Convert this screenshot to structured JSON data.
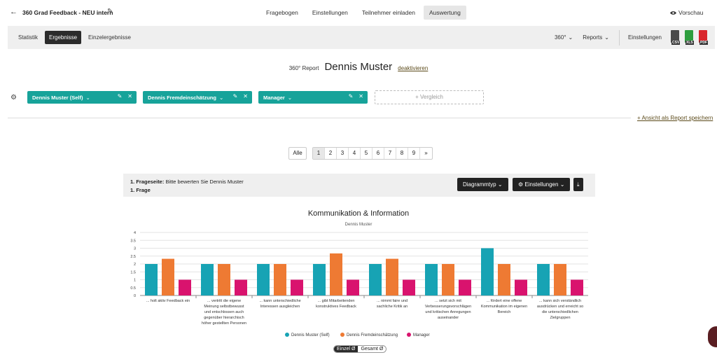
{
  "header": {
    "back_icon": "arrow-left-icon",
    "title": "360 Grad Feedback - NEU intern",
    "nav": [
      {
        "label": "Fragebogen",
        "active": false
      },
      {
        "label": "Einstellungen",
        "active": false
      },
      {
        "label": "Teilnehmer einladen",
        "active": false
      },
      {
        "label": "Auswertung",
        "active": true
      }
    ],
    "preview_label": "Vorschau"
  },
  "subnav": {
    "tabs": [
      {
        "label": "Statistik",
        "active": false
      },
      {
        "label": "Ergebnisse",
        "active": true
      },
      {
        "label": "Einzelergebnisse",
        "active": false
      }
    ],
    "dropdown_360": "360°",
    "dropdown_reports": "Reports",
    "settings_label": "Einstellungen",
    "exports": [
      {
        "label": "CSV",
        "color": "#4a4a4a"
      },
      {
        "label": "XLS",
        "color": "#2e9e3e"
      },
      {
        "label": "PDF",
        "color": "#d9262c"
      }
    ]
  },
  "report": {
    "label": "360° Report",
    "name": "Dennis Muster",
    "deactivate": "deaktivieren"
  },
  "filters": {
    "chips": [
      "Dennis Muster (Self)",
      "Dennis Fremdeinschätzung",
      "Manager"
    ],
    "compare_label": "+ Vergleich",
    "save_report_label": "+ Ansicht als Report speichern",
    "accent": "#17a39a"
  },
  "pagination": {
    "all_label": "Alle",
    "pages": [
      "1",
      "2",
      "3",
      "4",
      "5",
      "6",
      "7",
      "8",
      "9",
      "»"
    ],
    "active": "1"
  },
  "question": {
    "page_prefix": "1. Frageseite:",
    "page_text": "Bitte bewerten Sie Dennis Muster",
    "question_label": "1. Frage",
    "diagram_type_label": "Diagrammtyp",
    "settings_label": "Einstellungen"
  },
  "chart_data": {
    "type": "bar",
    "title": "Kommunikation & Information",
    "subtitle": "Dennis Muster",
    "ylim": [
      0,
      4
    ],
    "yticks": [
      "0",
      "0.5",
      "1",
      "1.5",
      "2",
      "2.5",
      "3",
      "3.5",
      "4"
    ],
    "categories": [
      "... holt aktiv Feedback ein",
      "... vertritt die eigene Meinung selbstbewusst und entschlossen auch gegenüber hierarchisch höher gestellten Personen",
      "... kann unterschiedliche Interessen ausgleichen",
      "... gibt Mitarbeitenden konstruktives Feedback",
      "... nimmt faire und sachliche Kritik an",
      "... setzt sich mit Verbesserungsvorschlägen und kritischen Anregungen auseinander",
      "... fördert eine offene Kommunikation im eigenen Bereich",
      "... kann sich verständlich ausdrücken und erreicht so die unterschiedlichen Zielgruppen"
    ],
    "category_lines": [
      [
        "... holt aktiv Feedback ein"
      ],
      [
        "... vertritt die eigene",
        "Meinung selbstbewusst",
        "und entschlossen auch",
        "gegenüber hierarchisch",
        "höher gestellten Personen"
      ],
      [
        "... kann unterschiedliche",
        "Interessen ausgleichen"
      ],
      [
        "... gibt Mitarbeitenden",
        "konstruktives Feedback"
      ],
      [
        "... nimmt faire und",
        "sachliche Kritik an"
      ],
      [
        "... setzt sich mit",
        "Verbesserungsvorschlägen",
        "und kritischen Anregungen",
        "auseinander"
      ],
      [
        "... fördert eine offene",
        "Kommunikation im eigenen",
        "Bereich"
      ],
      [
        "... kann sich verständlich",
        "ausdrücken und erreicht so",
        "die unterschiedlichen",
        "Zielgruppen"
      ]
    ],
    "series": [
      {
        "name": "Dennis Muster (Self)",
        "color": "#17a3b4",
        "values": [
          2,
          2,
          2,
          2,
          2,
          2,
          3,
          2
        ]
      },
      {
        "name": "Dennis Fremdeinschätzung",
        "color": "#ee7a33",
        "values": [
          2.33,
          2,
          2,
          2.67,
          2.33,
          2,
          2,
          2
        ]
      },
      {
        "name": "Manager",
        "color": "#d9136e",
        "values": [
          1,
          1,
          1,
          1,
          1,
          1,
          1,
          1
        ]
      }
    ],
    "grid": true,
    "legend": "bottom"
  },
  "view_toggle": [
    {
      "label": "Einzel Ø",
      "active": true
    },
    {
      "label": "Gesamt Ø",
      "active": false
    }
  ]
}
